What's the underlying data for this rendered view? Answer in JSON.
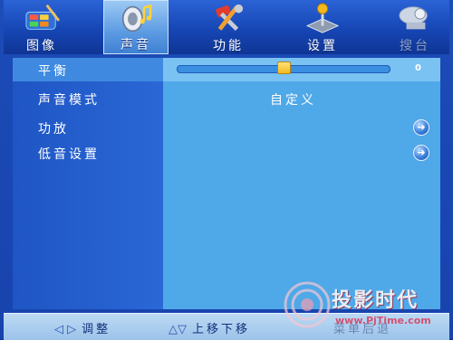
{
  "menu": {
    "tabs": [
      {
        "label": "图像",
        "icon": "palette-icon",
        "state": "normal"
      },
      {
        "label": "声音",
        "icon": "speaker-icon",
        "state": "active"
      },
      {
        "label": "功能",
        "icon": "tools-icon",
        "state": "normal"
      },
      {
        "label": "设置",
        "icon": "joystick-icon",
        "state": "normal"
      },
      {
        "label": "搜台",
        "icon": "satellite-dish-icon",
        "state": "disabled"
      }
    ]
  },
  "settings": {
    "balance": {
      "label": "平衡",
      "value": "0",
      "slider_fraction": 0.5
    },
    "sound_mode": {
      "label": "声音模式",
      "value": "自定义"
    },
    "amplifier": {
      "label": "功放",
      "icon": "arrow-right-icon"
    },
    "bass_settings": {
      "label": "低音设置",
      "icon": "arrow-right-icon"
    }
  },
  "hints": {
    "adjust": {
      "glyphs": "◁ ▷",
      "label": "调整"
    },
    "move": {
      "glyphs": "△▽",
      "label": "上移下移"
    },
    "exit": {
      "label": "菜单后退"
    }
  },
  "watermark": {
    "title": "投影时代",
    "url": "www.PjTime.com"
  },
  "colors": {
    "accent": "#4fa8e8",
    "background": "#1843ad",
    "slider_thumb": "#f2b81c"
  }
}
